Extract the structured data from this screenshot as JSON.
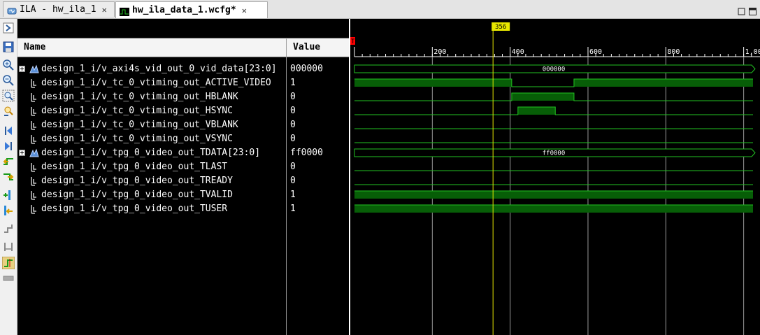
{
  "tabs": [
    {
      "label": "ILA - hw_ila_1",
      "close": "✕",
      "icon": "ila-icon",
      "active": false
    },
    {
      "label": "hw_ila_data_1.wcfg*",
      "close": "✕",
      "icon": "waveform-icon",
      "active": true
    }
  ],
  "window_controls": [
    "restore-icon",
    "maximize-icon"
  ],
  "toolbar": [
    "expand-icon",
    "save-icon",
    "zoom-in-icon",
    "zoom-out-icon",
    "zoom-fit-icon",
    "zoom-cursor-icon",
    "go-to-start-icon",
    "go-to-end-icon",
    "previous-transition-icon",
    "next-transition-icon",
    "add-marker-icon",
    "previous-marker-icon",
    "next-marker-icon",
    "swap-cursors-icon",
    "snap-to-transition-icon",
    "floating-ruler-icon"
  ],
  "columns": {
    "name": "Name",
    "value": "Value"
  },
  "signals": [
    {
      "name": "design_1_i/v_axi4s_vid_out_0_vid_data[23:0]",
      "value": "000000",
      "bus": true
    },
    {
      "name": "design_1_i/v_tc_0_vtiming_out_ACTIVE_VIDEO",
      "value": "1",
      "bus": false
    },
    {
      "name": "design_1_i/v_tc_0_vtiming_out_HBLANK",
      "value": "0",
      "bus": false
    },
    {
      "name": "design_1_i/v_tc_0_vtiming_out_HSYNC",
      "value": "0",
      "bus": false
    },
    {
      "name": "design_1_i/v_tc_0_vtiming_out_VBLANK",
      "value": "0",
      "bus": false
    },
    {
      "name": "design_1_i/v_tc_0_vtiming_out_VSYNC",
      "value": "0",
      "bus": false
    },
    {
      "name": "design_1_i/v_tpg_0_video_out_TDATA[23:0]",
      "value": "ff0000",
      "bus": true
    },
    {
      "name": "design_1_i/v_tpg_0_video_out_TLAST",
      "value": "0",
      "bus": false
    },
    {
      "name": "design_1_i/v_tpg_0_video_out_TREADY",
      "value": "0",
      "bus": false
    },
    {
      "name": "design_1_i/v_tpg_0_video_out_TVALID",
      "value": "1",
      "bus": false
    },
    {
      "name": "design_1_i/v_tpg_0_video_out_TUSER",
      "value": "1",
      "bus": false
    }
  ],
  "timeline": {
    "start": 0,
    "end": 1024,
    "major_ticks": [
      0,
      200,
      400,
      600,
      800,
      1000
    ],
    "major_labels": [
      "",
      "200",
      "400",
      "600",
      "800",
      "1,00"
    ],
    "cursor": {
      "value": 356,
      "label": "356"
    },
    "trigger_marker": "T"
  },
  "waves": [
    {
      "kind": "bus",
      "label": "000000",
      "segments": [
        [
          0,
          1024
        ]
      ]
    },
    {
      "kind": "bit",
      "highs": [
        [
          0,
          404
        ],
        [
          564,
          1024
        ]
      ]
    },
    {
      "kind": "bit",
      "highs": [
        [
          404,
          564
        ]
      ]
    },
    {
      "kind": "bit",
      "highs": [
        [
          420,
          516
        ]
      ]
    },
    {
      "kind": "bit",
      "highs": []
    },
    {
      "kind": "bit",
      "highs": []
    },
    {
      "kind": "bus",
      "label": "ff0000",
      "segments": [
        [
          0,
          1024
        ]
      ]
    },
    {
      "kind": "bit",
      "highs": []
    },
    {
      "kind": "bit",
      "highs": []
    },
    {
      "kind": "bit",
      "highs": [
        [
          0,
          1024
        ]
      ]
    },
    {
      "kind": "bit",
      "highs": [
        [
          0,
          1024
        ]
      ]
    }
  ],
  "colors": {
    "wave": "#22c222",
    "wave_fill": "#075e07",
    "grid": "#9a9a9a",
    "cursor": "#e8e800",
    "trigger": "#ff0000",
    "bus_fill": "#000000"
  }
}
